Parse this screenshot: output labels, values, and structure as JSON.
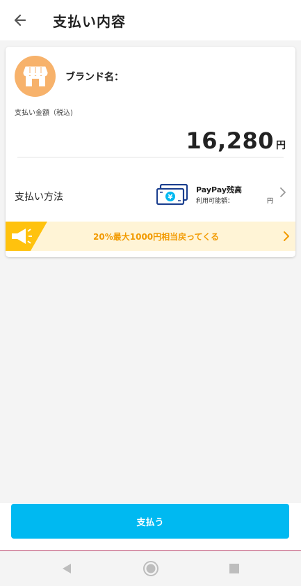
{
  "header": {
    "title": "支払い内容"
  },
  "card": {
    "brand_label": "ブランド名：",
    "amount_label": "支払い金額（税込)",
    "amount_value": "16,280",
    "amount_unit": "円",
    "payment_method_label": "支払い方法",
    "payment_method_name": "PayPay残高",
    "payment_method_sub": "利用可能額：",
    "payment_method_sub_unit": "円"
  },
  "promo": {
    "text": "20%最大1000円相当戻ってくる"
  },
  "footer": {
    "pay_button_label": "支払う"
  },
  "colors": {
    "accent": "#00b9f1",
    "promo_text": "#f29a00",
    "promo_bg": "#fff4d6",
    "shop_icon_bg": "#f7b26b"
  },
  "icons": {
    "back": "arrow-left",
    "shop": "storefront",
    "payment": "banknote-yen",
    "promo": "megaphone",
    "nav_back": "triangle-left",
    "nav_home": "circle",
    "nav_recent": "square"
  }
}
